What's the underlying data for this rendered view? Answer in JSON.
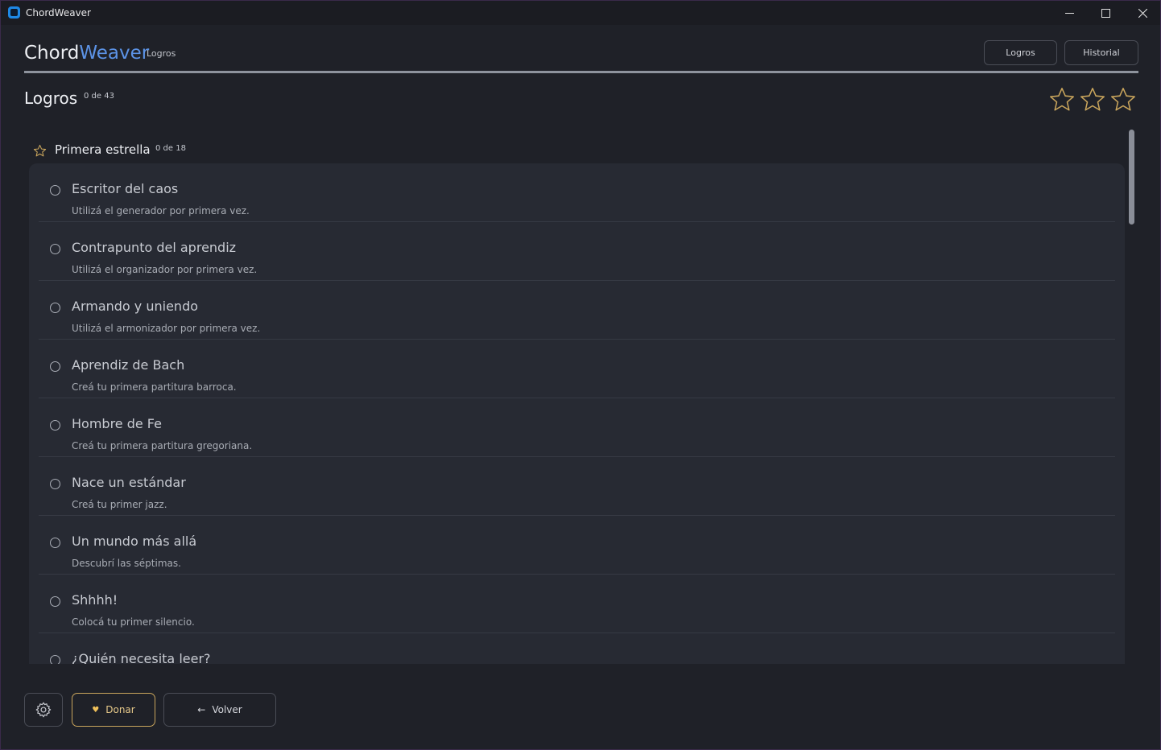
{
  "window": {
    "title": "ChordWeaver"
  },
  "header": {
    "brand_part1": "Chord",
    "brand_part2": "Weaver",
    "subtitle": "Logros",
    "nav": {
      "logros_label": "Logros",
      "historial_label": "Historial"
    }
  },
  "page": {
    "title": "Logros",
    "count": "0 de 43",
    "stars_earned": 0,
    "stars_total": 3
  },
  "section": {
    "title": "Primera estrella",
    "count": "0 de 18",
    "items": [
      {
        "title": "Escritor del caos",
        "description": "Utilizá el generador por primera vez."
      },
      {
        "title": "Contrapunto del aprendiz",
        "description": "Utilizá el organizador por primera vez."
      },
      {
        "title": "Armando y uniendo",
        "description": "Utilizá el armonizador por primera vez."
      },
      {
        "title": "Aprendiz de Bach",
        "description": "Creá tu primera partitura barroca."
      },
      {
        "title": "Hombre de Fe",
        "description": "Creá tu primera partitura gregoriana."
      },
      {
        "title": "Nace un estándar",
        "description": "Creá tu primer jazz."
      },
      {
        "title": "Un mundo más allá",
        "description": "Descubrí las séptimas."
      },
      {
        "title": "Shhhh!",
        "description": "Colocá tu primer silencio."
      },
      {
        "title": "¿Quién necesita leer?",
        "description": ""
      }
    ]
  },
  "footer": {
    "settings_icon": "gear-icon",
    "donate_label": "Donar",
    "donate_icon": "heart-icon",
    "back_label": "Volver",
    "back_icon": "arrow-left-icon"
  },
  "colors": {
    "background": "#1f2128",
    "accent": "#5c93e6",
    "star": "#c9a55c",
    "card": "#272a33"
  }
}
